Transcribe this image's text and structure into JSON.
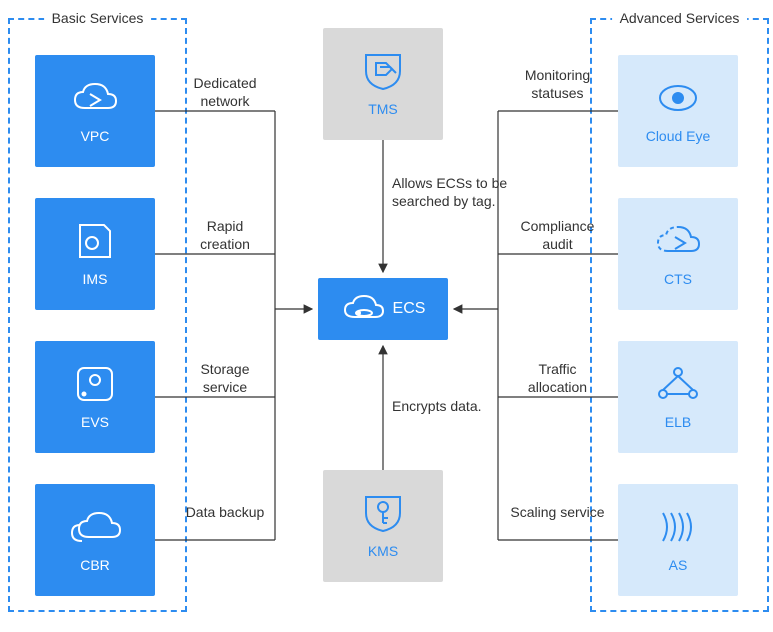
{
  "panels": {
    "left_title": "Basic Services",
    "right_title": "Advanced Services"
  },
  "center": {
    "ecs": "ECS",
    "tms": "TMS",
    "kms": "KMS",
    "tms_edge": "Allows ECSs to be searched by tag.",
    "kms_edge": "Encrypts data."
  },
  "left": {
    "vpc": {
      "label": "VPC",
      "edge": "Dedicated network"
    },
    "ims": {
      "label": "IMS",
      "edge": "Rapid creation"
    },
    "evs": {
      "label": "EVS",
      "edge": "Storage service"
    },
    "cbr": {
      "label": "CBR",
      "edge": "Data backup"
    }
  },
  "right": {
    "cloud_eye": {
      "label": "Cloud Eye",
      "edge": "Monitoring statuses"
    },
    "cts": {
      "label": "CTS",
      "edge": "Compliance audit"
    },
    "elb": {
      "label": "ELB",
      "edge": "Traffic allocation"
    },
    "as": {
      "label": "AS",
      "edge": "Scaling service"
    }
  }
}
